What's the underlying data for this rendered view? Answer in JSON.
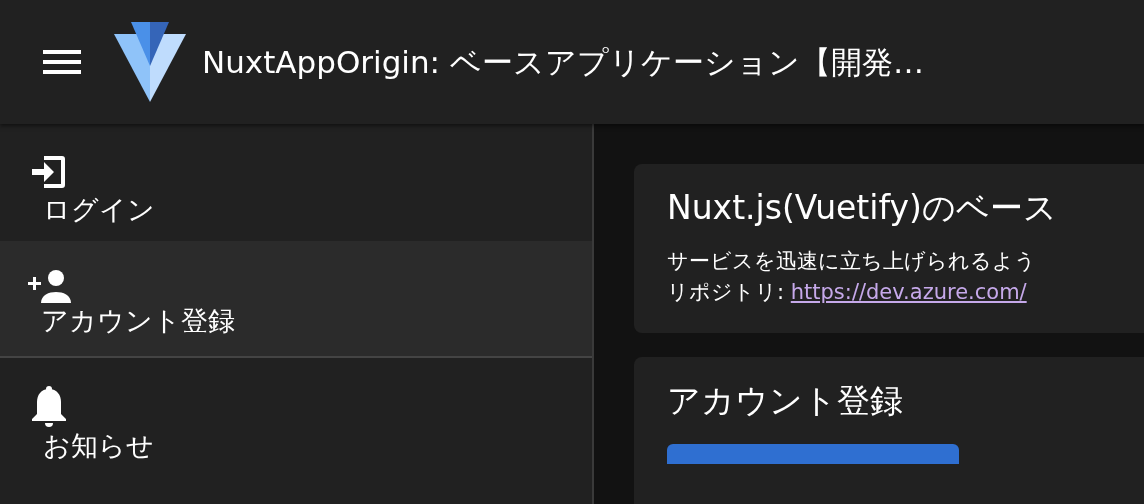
{
  "app_bar": {
    "title": "NuxtAppOrigin: ベースアプリケーション【開発…"
  },
  "sidebar": {
    "items": [
      {
        "kind": "login",
        "label": "ログイン",
        "selected": false
      },
      {
        "kind": "person-add",
        "label": "アカウント登録",
        "selected": true
      },
      {
        "kind": "bell",
        "label": "お知らせ",
        "selected": false
      }
    ]
  },
  "cards": [
    {
      "title": "Nuxt.js(Vuetify)のベース",
      "text": "サービスを迅速に立ち上げられるよう",
      "link_prefix": "リポジトリ: ",
      "link": "https://dev.azure.com/"
    },
    {
      "title": "アカウント登録",
      "has_button": true
    }
  ]
}
